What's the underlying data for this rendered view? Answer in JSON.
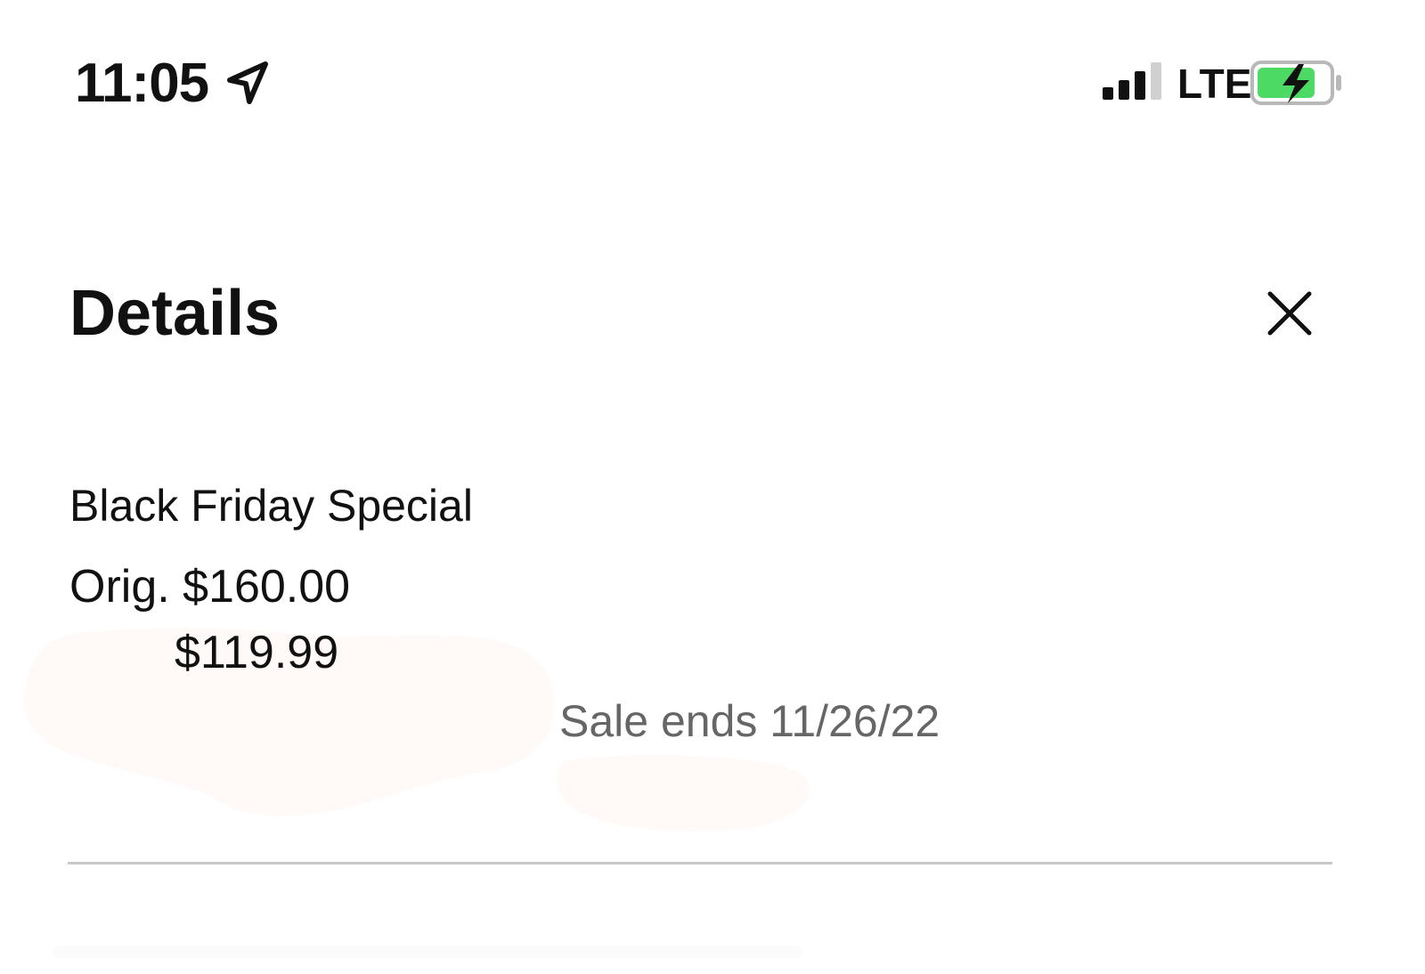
{
  "status_bar": {
    "time": "11:05",
    "network": "LTE",
    "icons": [
      "location-arrow-icon",
      "signal-icon",
      "battery-charging-icon"
    ],
    "battery_color": "#4cd964"
  },
  "header": {
    "title": "Details",
    "close_icon": "close-icon"
  },
  "offer": {
    "name": "Black Friday Special",
    "original_price": "Orig. $160.00",
    "sale_price": "$119.99",
    "sale_ends": "Sale ends 11/26/22"
  },
  "colors": {
    "text": "#111111",
    "muted_text": "#666666",
    "divider": "#c8c8c8",
    "background": "#ffffff"
  }
}
